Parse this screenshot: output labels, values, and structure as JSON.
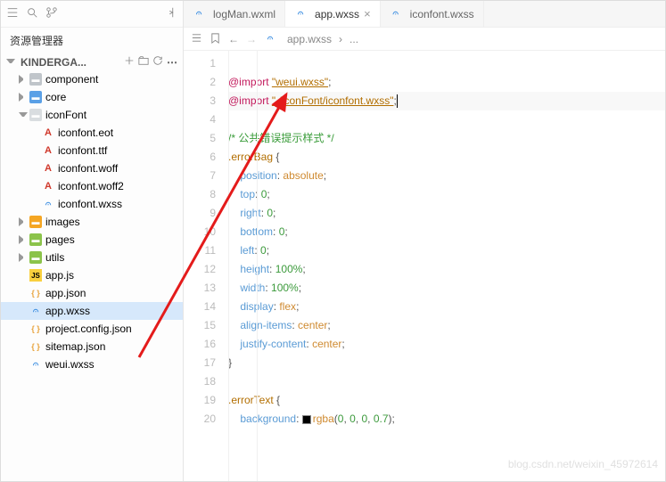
{
  "explorer_title": "资源管理器",
  "project_name": "KINDERGA...",
  "tree": [
    {
      "l": "component",
      "i": "folder",
      "d": 1,
      "a": "r"
    },
    {
      "l": "core",
      "i": "folder blue",
      "d": 1,
      "a": "r"
    },
    {
      "l": "iconFont",
      "i": "folder open",
      "d": 1,
      "a": "d"
    },
    {
      "l": "iconfont.eot",
      "i": "A",
      "d": 2
    },
    {
      "l": "iconfont.ttf",
      "i": "A",
      "d": 2
    },
    {
      "l": "iconfont.woff",
      "i": "A",
      "d": 2
    },
    {
      "l": "iconfont.woff2",
      "i": "A",
      "d": 2
    },
    {
      "l": "iconfont.wxss",
      "i": "c3",
      "d": 2
    },
    {
      "l": "images",
      "i": "folder orange",
      "d": 1,
      "a": "r"
    },
    {
      "l": "pages",
      "i": "folder green",
      "d": 1,
      "a": "r"
    },
    {
      "l": "utils",
      "i": "folder green",
      "d": 1,
      "a": "r"
    },
    {
      "l": "app.js",
      "i": "js",
      "d": 1
    },
    {
      "l": "app.json",
      "i": "json",
      "d": 1
    },
    {
      "l": "app.wxss",
      "i": "c3",
      "d": 1,
      "sel": true
    },
    {
      "l": "project.config.json",
      "i": "json",
      "d": 1
    },
    {
      "l": "sitemap.json",
      "i": "json",
      "d": 1
    },
    {
      "l": "weui.wxss",
      "i": "c3",
      "d": 1
    }
  ],
  "tabs": [
    {
      "l": "logMan.wxml",
      "i": "c3"
    },
    {
      "l": "app.wxss",
      "i": "c3",
      "active": true,
      "close": true
    },
    {
      "l": "iconfont.wxss",
      "i": "c3"
    }
  ],
  "breadcrumb": {
    "file": "app.wxss",
    "more": "..."
  },
  "code": [
    {
      "n": 1,
      "seg": []
    },
    {
      "n": 2,
      "seg": [
        [
          "kw",
          "@import"
        ],
        [
          "pun",
          " "
        ],
        [
          "str",
          "\"weui.wxss\""
        ],
        [
          "pun",
          ";"
        ]
      ]
    },
    {
      "n": 3,
      "cur": true,
      "seg": [
        [
          "kw",
          "@import"
        ],
        [
          "pun",
          " "
        ],
        [
          "str",
          "\"./iconFont/iconfont.wxss\""
        ],
        [
          "pun",
          ";"
        ],
        [
          "cursor",
          ""
        ]
      ]
    },
    {
      "n": 4,
      "seg": []
    },
    {
      "n": 5,
      "seg": [
        [
          "cm",
          "/* 公共错误提示样式 */"
        ]
      ]
    },
    {
      "n": 6,
      "seg": [
        [
          "sel2",
          ".errorBag"
        ],
        [
          "pun",
          " {"
        ]
      ]
    },
    {
      "n": 7,
      "seg": [
        [
          "pun",
          "    "
        ],
        [
          "prop",
          "position"
        ],
        [
          "pun",
          ": "
        ],
        [
          "val",
          "absolute"
        ],
        [
          "pun",
          ";"
        ]
      ]
    },
    {
      "n": 8,
      "seg": [
        [
          "pun",
          "    "
        ],
        [
          "prop",
          "top"
        ],
        [
          "pun",
          ": "
        ],
        [
          "num",
          "0"
        ],
        [
          "pun",
          ";"
        ]
      ]
    },
    {
      "n": 9,
      "seg": [
        [
          "pun",
          "    "
        ],
        [
          "prop",
          "right"
        ],
        [
          "pun",
          ": "
        ],
        [
          "num",
          "0"
        ],
        [
          "pun",
          ";"
        ]
      ]
    },
    {
      "n": 10,
      "seg": [
        [
          "pun",
          "    "
        ],
        [
          "prop",
          "bottom"
        ],
        [
          "pun",
          ": "
        ],
        [
          "num",
          "0"
        ],
        [
          "pun",
          ";"
        ]
      ]
    },
    {
      "n": 11,
      "seg": [
        [
          "pun",
          "    "
        ],
        [
          "prop",
          "left"
        ],
        [
          "pun",
          ": "
        ],
        [
          "num",
          "0"
        ],
        [
          "pun",
          ";"
        ]
      ]
    },
    {
      "n": 12,
      "seg": [
        [
          "pun",
          "    "
        ],
        [
          "prop",
          "height"
        ],
        [
          "pun",
          ": "
        ],
        [
          "num",
          "100%"
        ],
        [
          "pun",
          ";"
        ]
      ]
    },
    {
      "n": 13,
      "seg": [
        [
          "pun",
          "    "
        ],
        [
          "prop",
          "width"
        ],
        [
          "pun",
          ": "
        ],
        [
          "num",
          "100%"
        ],
        [
          "pun",
          ";"
        ]
      ]
    },
    {
      "n": 14,
      "seg": [
        [
          "pun",
          "    "
        ],
        [
          "prop",
          "display"
        ],
        [
          "pun",
          ": "
        ],
        [
          "val",
          "flex"
        ],
        [
          "pun",
          ";"
        ]
      ]
    },
    {
      "n": 15,
      "seg": [
        [
          "pun",
          "    "
        ],
        [
          "prop",
          "align-items"
        ],
        [
          "pun",
          ": "
        ],
        [
          "val",
          "center"
        ],
        [
          "pun",
          ";"
        ]
      ]
    },
    {
      "n": 16,
      "seg": [
        [
          "pun",
          "    "
        ],
        [
          "prop",
          "justify-content"
        ],
        [
          "pun",
          ": "
        ],
        [
          "val",
          "center"
        ],
        [
          "pun",
          ";"
        ]
      ]
    },
    {
      "n": 17,
      "seg": [
        [
          "pun",
          "}"
        ]
      ]
    },
    {
      "n": 18,
      "seg": []
    },
    {
      "n": 19,
      "seg": [
        [
          "sel2",
          ".errorText"
        ],
        [
          "pun",
          " {"
        ]
      ]
    },
    {
      "n": 20,
      "seg": [
        [
          "pun",
          "    "
        ],
        [
          "prop",
          "background"
        ],
        [
          "pun",
          ": "
        ],
        [
          "swatch",
          ""
        ],
        [
          "val",
          "rgba"
        ],
        [
          "pun",
          "("
        ],
        [
          "num",
          "0"
        ],
        [
          "pun",
          ", "
        ],
        [
          "num",
          "0"
        ],
        [
          "pun",
          ", "
        ],
        [
          "num",
          "0"
        ],
        [
          "pun",
          ", "
        ],
        [
          "num",
          "0.7"
        ],
        [
          "pun",
          ");"
        ]
      ]
    }
  ],
  "watermark": "blog.csdn.net/weixin_45972614"
}
